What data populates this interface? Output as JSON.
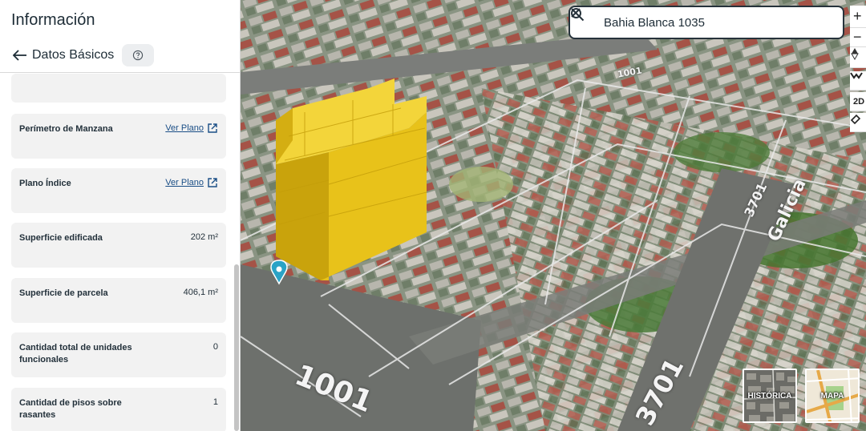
{
  "panel": {
    "title": "Información",
    "subtitle": "Datos Básicos",
    "help_icon": "question-circle-icon",
    "cards": [
      {
        "label": "",
        "value": ""
      },
      {
        "label": "Perímetro de Manzana",
        "link": "Ver Plano",
        "link_icon": "external-link-icon"
      },
      {
        "label": "Plano Índice",
        "link": "Ver Plano",
        "link_icon": "external-link-icon"
      },
      {
        "label": "Superficie edificada",
        "value": "202 m²"
      },
      {
        "label": "Superficie de parcela",
        "value": "406,1 m²"
      },
      {
        "label": "Cantidad total de unidades funcionales",
        "value": "0"
      },
      {
        "label": "Cantidad de pisos sobre rasantes",
        "value": "1"
      }
    ]
  },
  "search": {
    "value": "Bahia Blanca 1035",
    "icon": "search-icon",
    "clear_icon": "close-icon"
  },
  "map": {
    "street_labels": [
      "1001",
      "3701",
      "Galicia",
      "1001",
      "3701"
    ],
    "controls": [
      "+",
      "−",
      "compass",
      "tilt",
      "2D",
      "draw"
    ],
    "control_2d_label": "2D",
    "thumbnails": [
      "HISTÓRICA",
      "MAPA"
    ]
  },
  "colors": {
    "accent_link": "#1a4e86",
    "building": "#e8c21a",
    "marker": "#2aa3c6",
    "card_bg": "#f2f2f2"
  }
}
